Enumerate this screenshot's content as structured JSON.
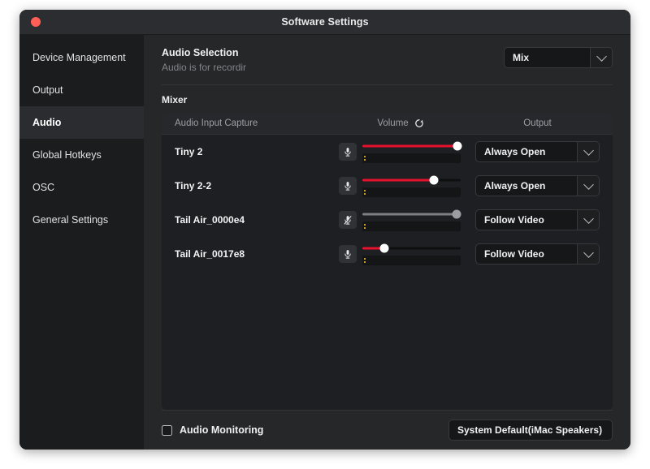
{
  "window": {
    "title": "Software Settings",
    "close_button": "close"
  },
  "sidebar": {
    "items": [
      {
        "label": "Device Management",
        "active": false
      },
      {
        "label": "Output",
        "active": false
      },
      {
        "label": "Audio",
        "active": true
      },
      {
        "label": "Global Hotkeys",
        "active": false
      },
      {
        "label": "OSC",
        "active": false
      },
      {
        "label": "General Settings",
        "active": false
      }
    ]
  },
  "audio_selection": {
    "title": "Audio Selection",
    "subtitle": "Audio is for recordir",
    "dropdown_value": "Mix"
  },
  "mixer": {
    "title": "Mixer",
    "columns": {
      "name": "Audio Input Capture",
      "volume": "Volume",
      "output": "Output"
    },
    "refresh_icon": "refresh-icon",
    "rows": [
      {
        "name": "Tiny 2",
        "mic_icon": "microphone-icon",
        "muted": false,
        "volume": 97,
        "output": "Always Open"
      },
      {
        "name": "Tiny 2-2",
        "mic_icon": "microphone-icon",
        "muted": false,
        "volume": 73,
        "output": "Always Open"
      },
      {
        "name": "Tail Air_0000e4",
        "mic_icon": "microphone-muted-icon",
        "muted": true,
        "volume": 96,
        "output": "Follow Video"
      },
      {
        "name": "Tail Air_0017e8",
        "mic_icon": "microphone-icon",
        "muted": false,
        "volume": 22,
        "output": "Follow Video"
      }
    ]
  },
  "footer": {
    "monitoring_label": "Audio Monitoring",
    "monitoring_checked": false,
    "device_value": "System Default(iMac Speakers)"
  },
  "colors": {
    "accent_red": "#e8112d",
    "muted_grey": "#7c7f83",
    "window_bg": "#202225",
    "sidebar_bg": "#1b1c1e",
    "content_bg": "#252729",
    "close_button": "#ff5f57"
  }
}
